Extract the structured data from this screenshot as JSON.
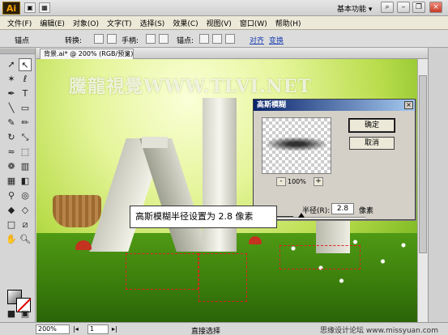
{
  "app": {
    "logo": "Ai",
    "workspace": "基本功能",
    "workspace_arrow": "▾"
  },
  "menu": [
    "文件(F)",
    "编辑(E)",
    "对象(O)",
    "文字(T)",
    "选择(S)",
    "效果(C)",
    "视图(V)",
    "窗口(W)",
    "帮助(H)"
  ],
  "control": {
    "anchor": "锚点",
    "convert": "转换:",
    "handle": "手柄:",
    "anchors": "锚点:",
    "align": "对齐",
    "transform": "变换"
  },
  "document": {
    "tab_label": "背景.ai* @ 200% (RGB/预览)",
    "close": "×",
    "watermark": "騰龍視覺WWW.TLVI.NET"
  },
  "dialog": {
    "title": "高斯模糊",
    "close": "×",
    "ok": "确定",
    "cancel": "取消",
    "zoom_minus": "-",
    "zoom_plus": "+",
    "zoom": "100%",
    "radius_label": "半径(R):",
    "radius_value": "2.8",
    "radius_unit": "像素",
    "radius_fraction": 0.28
  },
  "callout": {
    "text": "高斯模糊半径设置为 2.8 像素"
  },
  "status": {
    "zoom": "200%",
    "page": "1",
    "mode": "直接选择",
    "brand": "思缘设计论坛 www.missyuan.com"
  },
  "colors": {
    "title_bar_start": "#0a246a",
    "title_bar_end": "#a6caf0",
    "selection_path": "#e02020"
  }
}
